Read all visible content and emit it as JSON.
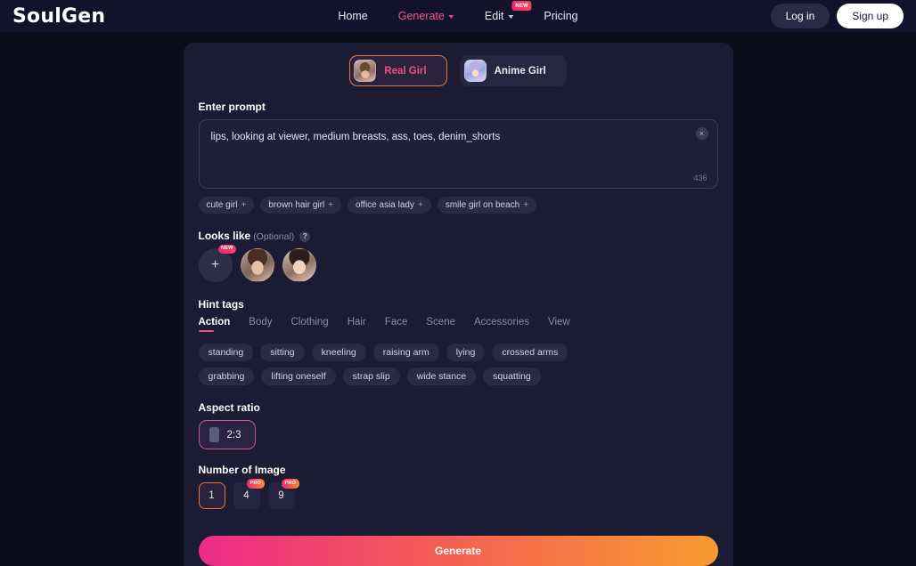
{
  "navbar": {
    "logo": "SoulGen",
    "links": [
      {
        "label": "Home",
        "caret": false,
        "new": false,
        "active": false
      },
      {
        "label": "Generate",
        "caret": true,
        "new": false,
        "active": true
      },
      {
        "label": "Edit",
        "caret": true,
        "new": true,
        "active": false
      },
      {
        "label": "Pricing",
        "caret": false,
        "new": false,
        "active": false
      }
    ],
    "new_badge_label": "NEW",
    "login_label": "Log in",
    "signup_label": "Sign up"
  },
  "type_tabs": [
    {
      "label": "Real Girl",
      "active": true
    },
    {
      "label": "Anime Girl",
      "active": false
    }
  ],
  "prompt": {
    "heading": "Enter prompt",
    "value": "lips, looking at viewer, medium breasts, ass, toes, denim_shorts",
    "char_count": "436",
    "clear_icon": "×"
  },
  "suggestion_chips": [
    {
      "label": "cute girl",
      "plus": "+"
    },
    {
      "label": "brown hair girl",
      "plus": "+"
    },
    {
      "label": "office asia lady",
      "plus": "+"
    },
    {
      "label": "smile girl on beach",
      "plus": "+"
    }
  ],
  "looks_like": {
    "heading": "Looks like",
    "optional": "(Optional)",
    "help_icon": "?",
    "add_label": "+",
    "new_badge_label": "NEW",
    "faces": [
      "face-portrait-1",
      "face-portrait-2"
    ]
  },
  "hint_tags": {
    "heading": "Hint tags",
    "tabs": [
      {
        "label": "Action",
        "active": true
      },
      {
        "label": "Body",
        "active": false
      },
      {
        "label": "Clothing",
        "active": false
      },
      {
        "label": "Hair",
        "active": false
      },
      {
        "label": "Face",
        "active": false
      },
      {
        "label": "Scene",
        "active": false
      },
      {
        "label": "Accessories",
        "active": false
      },
      {
        "label": "View",
        "active": false
      }
    ],
    "pills": [
      "standing",
      "sitting",
      "kneeling",
      "raising arm",
      "lying",
      "crossed arms",
      "grabbing",
      "lifting oneself",
      "strap slip",
      "wide stance",
      "squatting"
    ]
  },
  "aspect_ratio": {
    "heading": "Aspect ratio",
    "options": [
      {
        "label": "2:3",
        "active": true
      }
    ]
  },
  "number_of_image": {
    "heading": "Number of Image",
    "pro_badge_label": "PRO",
    "options": [
      {
        "label": "1",
        "active": true,
        "pro": false
      },
      {
        "label": "4",
        "active": false,
        "pro": true
      },
      {
        "label": "9",
        "active": false,
        "pro": true
      }
    ]
  },
  "generate": {
    "label": "Generate"
  },
  "colors": {
    "page_bg": "#0b0b1a",
    "panel_bg": "#1b1b33",
    "accent_pink": "#ef4f86",
    "accent_orange": "#f99b31",
    "gradient_start": "#ed2a87",
    "gradient_end": "#f99b31"
  }
}
